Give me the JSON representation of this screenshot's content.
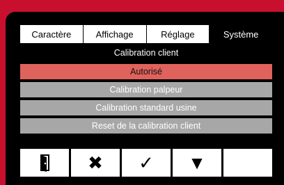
{
  "tabs": [
    {
      "label": "Caractère",
      "active": false
    },
    {
      "label": "Affichage",
      "active": false
    },
    {
      "label": "Réglage",
      "active": false
    },
    {
      "label": "Système",
      "active": true
    }
  ],
  "menu": {
    "title": "Calibration client",
    "items": [
      {
        "label": "Autorisé",
        "selected": true
      },
      {
        "label": "Calibration palpeur",
        "selected": false
      },
      {
        "label": "Calibration standard usine",
        "selected": false
      },
      {
        "label": "Reset de la calibration client",
        "selected": false
      }
    ]
  },
  "toolbar": {
    "buttons": [
      {
        "icon": "door-exit-icon"
      },
      {
        "icon": "cross-icon",
        "glyph": "✖"
      },
      {
        "icon": "checkmark-icon",
        "glyph": "✓"
      },
      {
        "icon": "down-triangle-icon",
        "glyph": "▼"
      },
      {
        "icon": "blank"
      }
    ]
  },
  "colors": {
    "bezel": "#c8102e",
    "selected_item": "#e0625c",
    "item": "#a7a7a7"
  }
}
